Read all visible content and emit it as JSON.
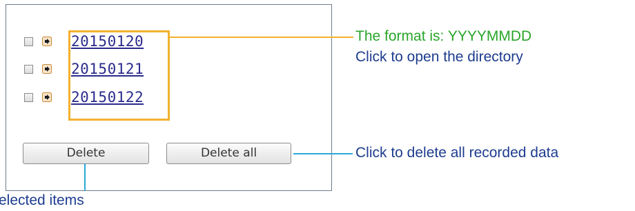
{
  "directory_list": {
    "items": [
      {
        "label": "20150120"
      },
      {
        "label": "20150121"
      },
      {
        "label": "20150122"
      }
    ]
  },
  "buttons": {
    "delete_label": "Delete",
    "delete_all_label": "Delete all"
  },
  "annotations": {
    "format_note": "The format is: YYYYMMDD",
    "open_note": "Click to open the directory",
    "delete_all_note": "Click to delete all recorded data",
    "delete_selected_note": "elected items"
  },
  "colors": {
    "highlight": "#f2b12e",
    "callout_line": "#2aa8d8",
    "format_text": "#2aa52a",
    "note_text": "#1d3c8f",
    "link": "#2a2a8c",
    "arrow_icon": "#e07b12"
  },
  "icons": {
    "row_icon": "arrow-right-icon"
  }
}
